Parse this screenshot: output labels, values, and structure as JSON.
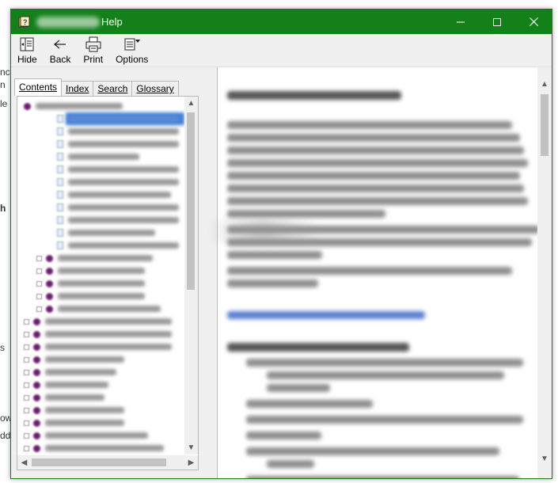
{
  "window": {
    "title_suffix": "Help",
    "title_blurred": true,
    "title_bar_color": "#13801a"
  },
  "titlebar_icons": {
    "app": "help-book-icon",
    "minimize": "minimize-icon",
    "maximize": "maximize-icon",
    "close": "close-icon"
  },
  "toolbar": {
    "buttons": [
      {
        "label": "Hide",
        "icon": "hide-pane-icon"
      },
      {
        "label": "Back",
        "icon": "back-arrow-icon"
      },
      {
        "label": "Print",
        "icon": "printer-icon"
      },
      {
        "label": "Options",
        "icon": "options-icon"
      }
    ]
  },
  "tabs": [
    {
      "label": "Contents",
      "active": true
    },
    {
      "label": "Index",
      "active": false
    },
    {
      "label": "Search",
      "active": false
    },
    {
      "label": "Glossary",
      "active": false
    }
  ],
  "tree": {
    "items_blurred": true,
    "selection_color": "#3f7fd8"
  },
  "content": {
    "text_blurred": true
  }
}
